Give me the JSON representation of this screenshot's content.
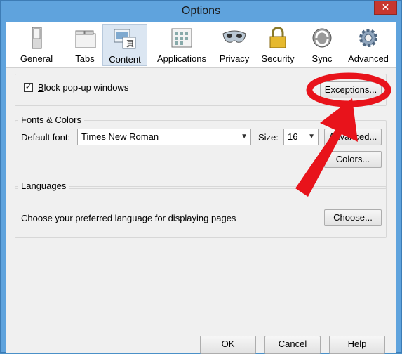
{
  "window": {
    "title": "Options",
    "close_glyph": "✕"
  },
  "toolbar": {
    "tabs": [
      {
        "label": "General",
        "icon": "general-switch-icon"
      },
      {
        "label": "Tabs",
        "icon": "tabs-icon"
      },
      {
        "label": "Content",
        "icon": "content-icon",
        "selected": true
      },
      {
        "label": "Applications",
        "icon": "applications-icon"
      },
      {
        "label": "Privacy",
        "icon": "privacy-mask-icon"
      },
      {
        "label": "Security",
        "icon": "lock-icon"
      },
      {
        "label": "Sync",
        "icon": "sync-icon"
      },
      {
        "label": "Advanced",
        "icon": "gear-icon"
      }
    ]
  },
  "popups": {
    "checkbox_label": "Block pop-up windows",
    "checked": true,
    "exceptions_button": "Exceptions..."
  },
  "fonts": {
    "group_title": "Fonts & Colors",
    "default_font_label": "Default font:",
    "default_font_value": "Times New Roman",
    "size_label": "Size:",
    "size_value": "16",
    "advanced_button": "Advanced...",
    "colors_button": "Colors..."
  },
  "languages": {
    "group_title": "Languages",
    "description": "Choose your preferred language for displaying pages",
    "choose_button": "Choose..."
  },
  "footer": {
    "ok_button": "OK",
    "cancel_button": "Cancel",
    "help_button": "Help"
  },
  "colors": {
    "annotation_red": "#e8131b",
    "selected_tab_bg": "#dbe6f2"
  }
}
